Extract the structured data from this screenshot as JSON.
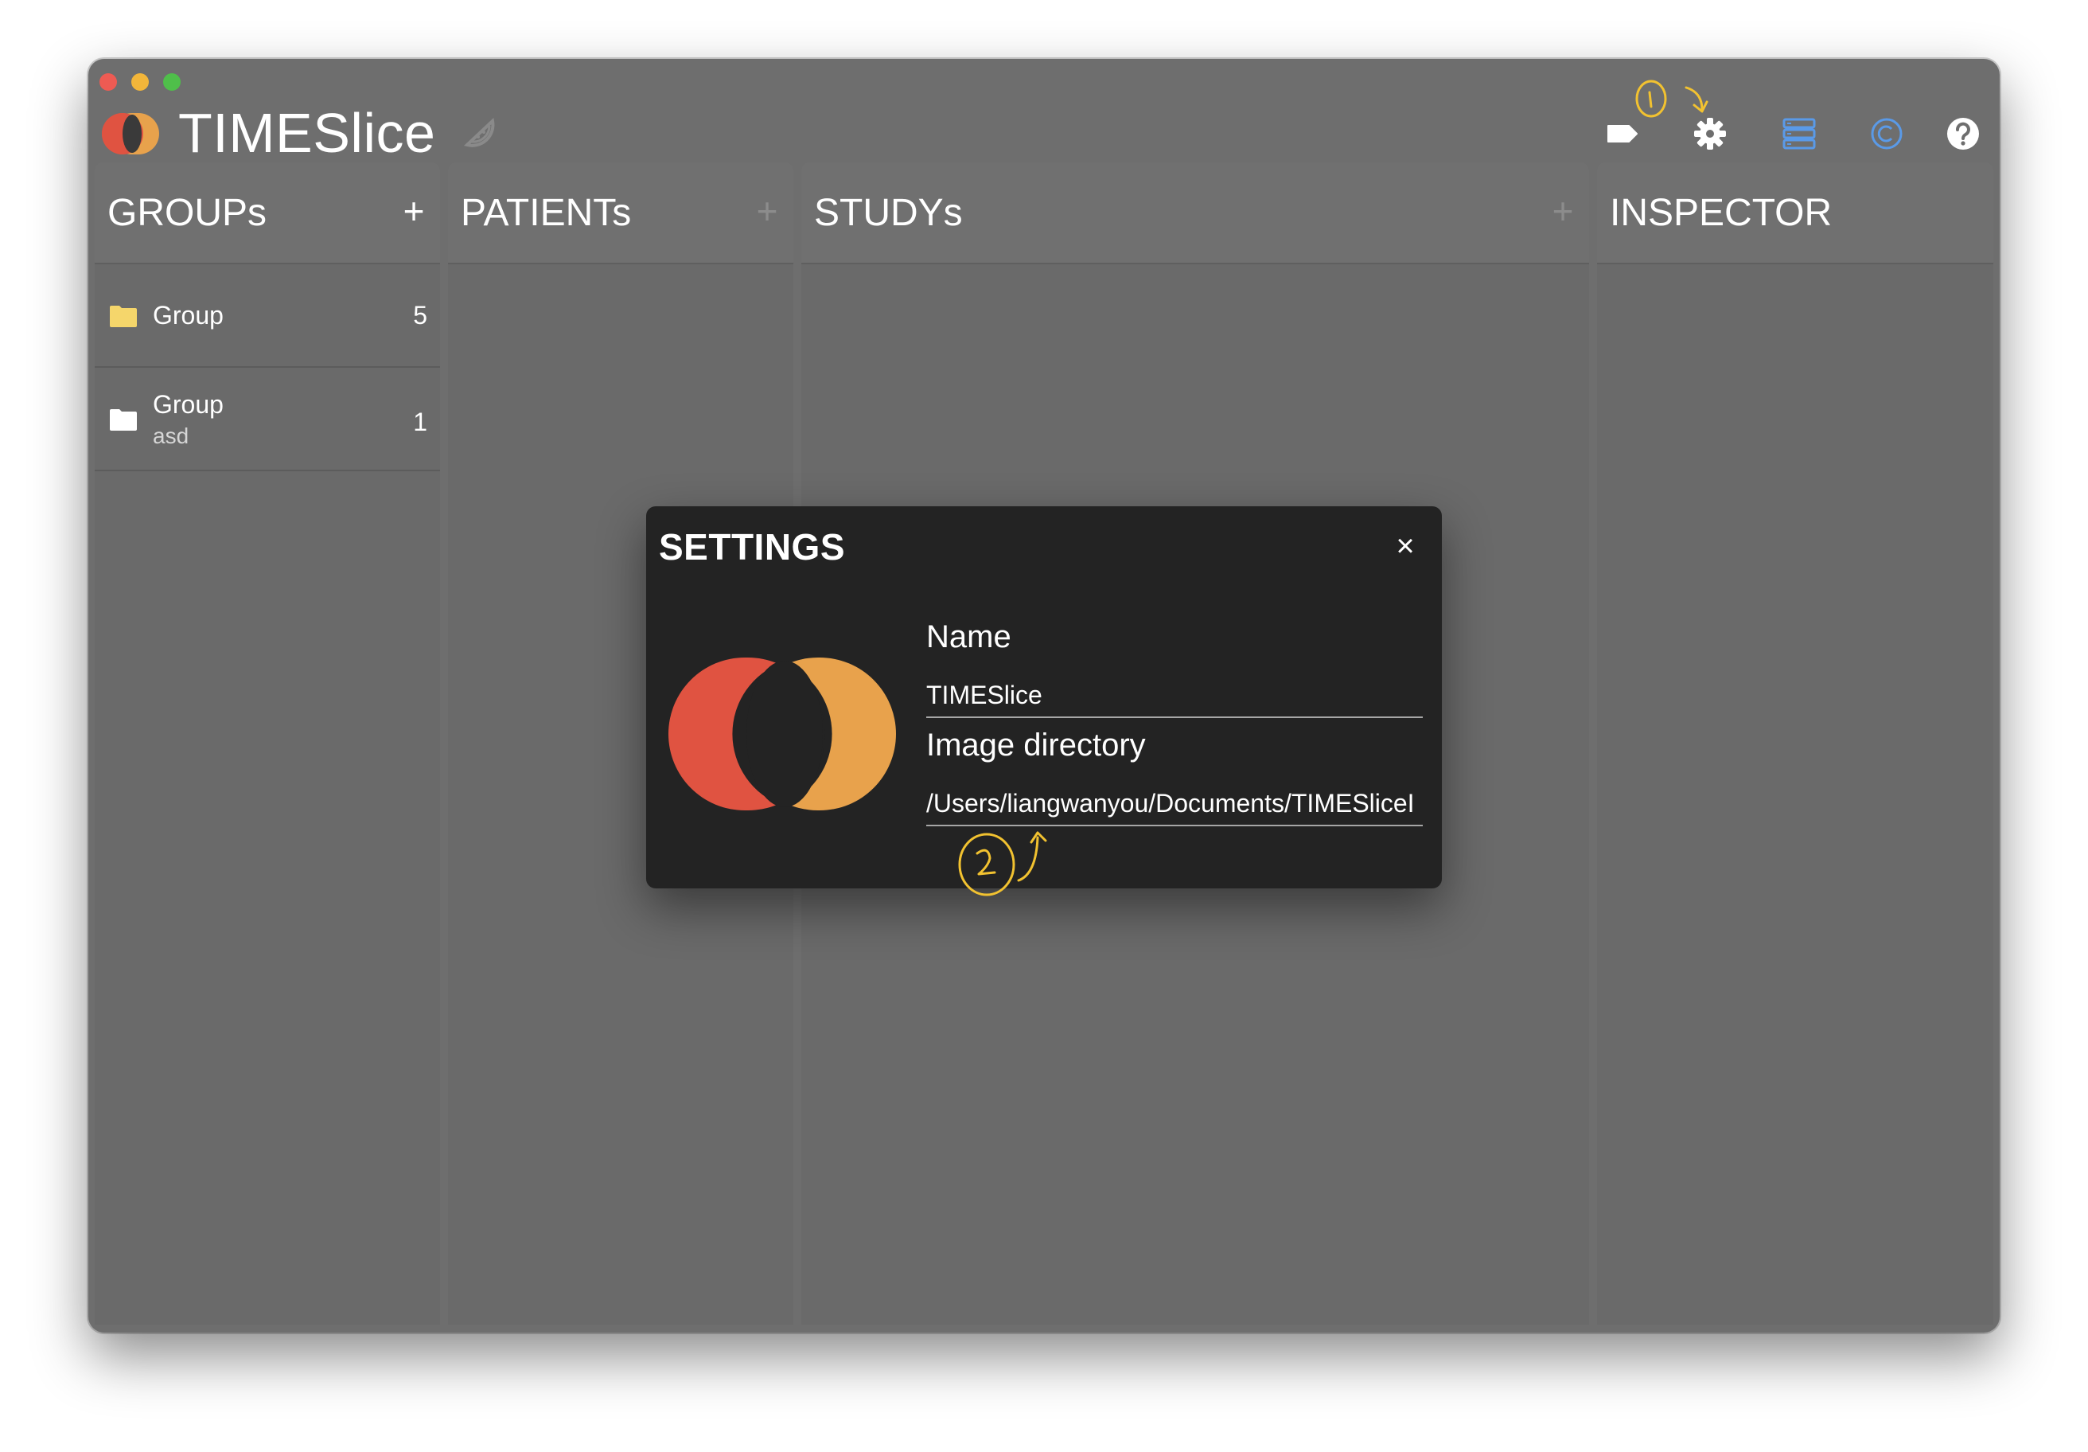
{
  "app": {
    "title": "TIMESlice"
  },
  "toolbar": {
    "icons": [
      "tag-icon",
      "gear-icon",
      "server-icon",
      "copyright-icon",
      "help-icon"
    ],
    "accent_blue": "#5a9ae8"
  },
  "colors": {
    "logo_red": "#e05341",
    "logo_orange": "#e8a24c",
    "folder_yellow": "#f5d66b",
    "annotation_yellow": "#f2c230"
  },
  "panels": {
    "groups": {
      "title": "GROUPs",
      "add_label": "+"
    },
    "patients": {
      "title": "PATIENTs",
      "add_label": "+"
    },
    "studys": {
      "title": "STUDYs",
      "add_label": "+"
    },
    "inspector": {
      "title": "INSPECTOR"
    }
  },
  "groups": [
    {
      "name": "Group",
      "subtitle": "",
      "count": "5"
    },
    {
      "name": "Group",
      "subtitle": "asd",
      "count": "1"
    }
  ],
  "settings": {
    "title": "SETTINGS",
    "close_label": "×",
    "name_label": "Name",
    "name_value": "TIMESlice",
    "image_dir_label": "Image directory",
    "image_dir_value": "/Users/liangwanyou/Documents/TIMESliceI"
  }
}
